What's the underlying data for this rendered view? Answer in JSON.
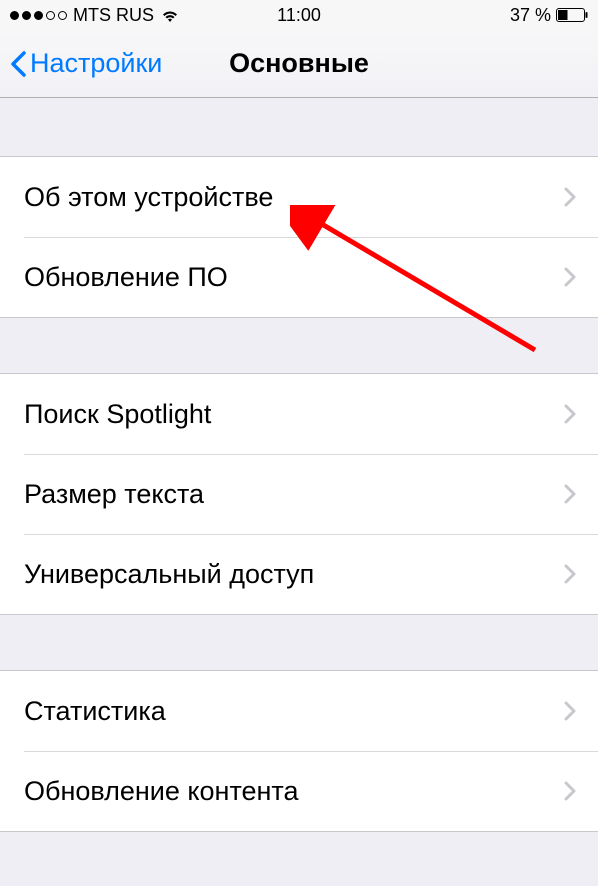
{
  "status_bar": {
    "carrier": "MTS RUS",
    "time": "11:00",
    "battery_percent": "37 %"
  },
  "nav": {
    "back_label": "Настройки",
    "title": "Основные"
  },
  "groups": [
    {
      "rows": [
        {
          "label": "Об этом устройстве"
        },
        {
          "label": "Обновление ПО"
        }
      ]
    },
    {
      "rows": [
        {
          "label": "Поиск Spotlight"
        },
        {
          "label": "Размер текста"
        },
        {
          "label": "Универсальный доступ"
        }
      ]
    },
    {
      "rows": [
        {
          "label": "Статистика"
        },
        {
          "label": "Обновление контента"
        }
      ]
    }
  ]
}
